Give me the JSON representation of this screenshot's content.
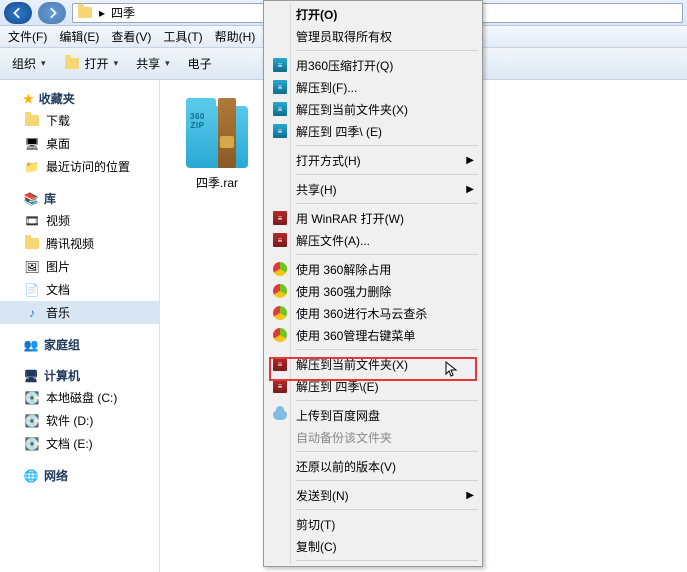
{
  "titlebar": {
    "path_name": "四季"
  },
  "menubar": {
    "file": "文件(F)",
    "edit": "编辑(E)",
    "view": "查看(V)",
    "tools": "工具(T)",
    "help": "帮助(H)"
  },
  "toolbar": {
    "organize": "组织",
    "open": "打开",
    "share": "共享",
    "email": "电子"
  },
  "sidebar": {
    "favorites": {
      "label": "收藏夹",
      "items": [
        {
          "label": "下载",
          "icon": "download"
        },
        {
          "label": "桌面",
          "icon": "desktop"
        },
        {
          "label": "最近访问的位置",
          "icon": "recent"
        }
      ]
    },
    "libraries": {
      "label": "库",
      "items": [
        {
          "label": "视频",
          "icon": "video"
        },
        {
          "label": "腾讯视频",
          "icon": "qqvideo"
        },
        {
          "label": "图片",
          "icon": "pictures"
        },
        {
          "label": "文档",
          "icon": "documents"
        },
        {
          "label": "音乐",
          "icon": "music",
          "selected": true
        }
      ]
    },
    "homegroup": {
      "label": "家庭组"
    },
    "computer": {
      "label": "计算机",
      "items": [
        {
          "label": "本地磁盘 (C:)"
        },
        {
          "label": "软件 (D:)"
        },
        {
          "label": "文档 (E:)"
        }
      ]
    },
    "network": {
      "label": "网络"
    }
  },
  "file": {
    "name": "四季.rar"
  },
  "context_menu": {
    "items": [
      {
        "type": "item",
        "label": "打开(O)",
        "bold": true
      },
      {
        "type": "item",
        "label": "管理员取得所有权"
      },
      {
        "type": "sep"
      },
      {
        "type": "item",
        "label": "用360压缩打开(Q)",
        "icon": "360zip"
      },
      {
        "type": "item",
        "label": "解压到(F)...",
        "icon": "360zip"
      },
      {
        "type": "item",
        "label": "解压到当前文件夹(X)",
        "icon": "360zip"
      },
      {
        "type": "item",
        "label": "解压到 四季\\ (E)",
        "icon": "360zip"
      },
      {
        "type": "sep"
      },
      {
        "type": "item",
        "label": "打开方式(H)",
        "submenu": true
      },
      {
        "type": "sep"
      },
      {
        "type": "item",
        "label": "共享(H)",
        "submenu": true
      },
      {
        "type": "sep"
      },
      {
        "type": "item",
        "label": "用 WinRAR 打开(W)",
        "icon": "rar"
      },
      {
        "type": "item",
        "label": "解压文件(A)...",
        "icon": "rar"
      },
      {
        "type": "sep"
      },
      {
        "type": "item",
        "label": "使用 360解除占用",
        "icon": "360"
      },
      {
        "type": "item",
        "label": "使用 360强力删除",
        "icon": "360"
      },
      {
        "type": "item",
        "label": "使用 360进行木马云查杀",
        "icon": "360ball"
      },
      {
        "type": "item",
        "label": "使用 360管理右键菜单",
        "icon": "360"
      },
      {
        "type": "sep"
      },
      {
        "type": "item",
        "label": "解压到当前文件夹(X)",
        "icon": "rar",
        "highlighted": true
      },
      {
        "type": "item",
        "label": "解压到 四季\\(E)",
        "icon": "rar"
      },
      {
        "type": "sep"
      },
      {
        "type": "item",
        "label": "上传到百度网盘",
        "icon": "cloud"
      },
      {
        "type": "item",
        "label": "自动备份该文件夹",
        "disabled": true
      },
      {
        "type": "sep"
      },
      {
        "type": "item",
        "label": "还原以前的版本(V)"
      },
      {
        "type": "sep"
      },
      {
        "type": "item",
        "label": "发送到(N)",
        "submenu": true
      },
      {
        "type": "sep"
      },
      {
        "type": "item",
        "label": "剪切(T)"
      },
      {
        "type": "item",
        "label": "复制(C)"
      },
      {
        "type": "sep"
      }
    ]
  }
}
